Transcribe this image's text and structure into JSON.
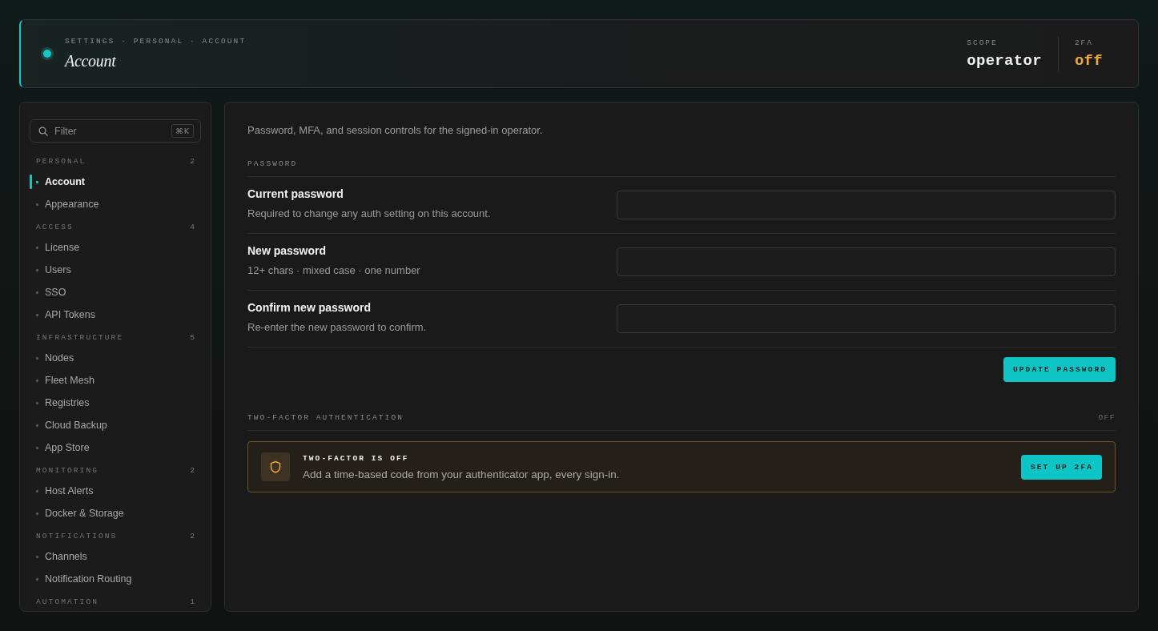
{
  "header": {
    "breadcrumb": "SETTINGS · PERSONAL · ACCOUNT",
    "title": "Account",
    "stats": [
      {
        "label": "SCOPE",
        "value": "operator",
        "kind": "neutral"
      },
      {
        "label": "2FA",
        "value": "off",
        "kind": "warning"
      }
    ]
  },
  "sidebar": {
    "filter": {
      "placeholder": "Filter",
      "shortcut": "⌘K"
    },
    "groups": [
      {
        "label": "PERSONAL",
        "count": "2",
        "items": [
          {
            "label": "Account",
            "selected": true
          },
          {
            "label": "Appearance",
            "selected": false
          }
        ]
      },
      {
        "label": "ACCESS",
        "count": "4",
        "items": [
          {
            "label": "License",
            "selected": false
          },
          {
            "label": "Users",
            "selected": false
          },
          {
            "label": "SSO",
            "selected": false
          },
          {
            "label": "API Tokens",
            "selected": false
          }
        ]
      },
      {
        "label": "INFRASTRUCTURE",
        "count": "5",
        "items": [
          {
            "label": "Nodes",
            "selected": false
          },
          {
            "label": "Fleet Mesh",
            "selected": false
          },
          {
            "label": "Registries",
            "selected": false
          },
          {
            "label": "Cloud Backup",
            "selected": false
          },
          {
            "label": "App Store",
            "selected": false
          }
        ]
      },
      {
        "label": "MONITORING",
        "count": "2",
        "items": [
          {
            "label": "Host Alerts",
            "selected": false
          },
          {
            "label": "Docker & Storage",
            "selected": false
          }
        ]
      },
      {
        "label": "NOTIFICATIONS",
        "count": "2",
        "items": [
          {
            "label": "Channels",
            "selected": false
          },
          {
            "label": "Notification Routing",
            "selected": false
          }
        ]
      },
      {
        "label": "AUTOMATION",
        "count": "1"
      }
    ]
  },
  "main": {
    "intro": "Password, MFA, and session controls for the signed-in operator.",
    "password": {
      "title": "PASSWORD",
      "fields": [
        {
          "label": "Current password",
          "hint": "Required to change any auth setting on this account."
        },
        {
          "label": "New password",
          "hint": "12+ chars · mixed case · one number"
        },
        {
          "label": "Confirm new password",
          "hint": "Re-enter the new password to confirm."
        }
      ],
      "button": "UPDATE PASSWORD"
    },
    "two_factor": {
      "title": "TWO-FACTOR AUTHENTICATION",
      "status": "OFF",
      "alert": {
        "title": "TWO-FACTOR IS OFF",
        "text": "Add a time-based code from your authenticator app, every sign-in.",
        "button": "SET UP 2FA"
      }
    }
  }
}
